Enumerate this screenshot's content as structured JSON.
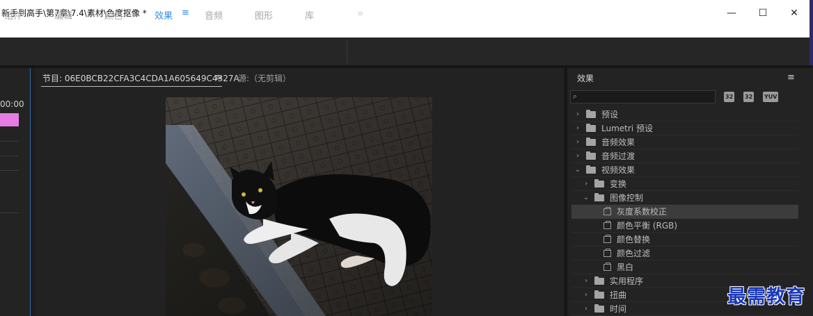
{
  "window": {
    "title": "新手到高手\\第7章\\7.4\\素材\\色度抠像 *",
    "minimize": "—",
    "maximize": "☐",
    "close": "✕"
  },
  "nav": {
    "items": [
      "组件",
      "编辑",
      "颜色",
      "效果",
      "音频",
      "图形",
      "库"
    ],
    "active_index": 3,
    "menu_icon": "≡",
    "more_icon": "»"
  },
  "timeline": {
    "timecode": "00:00",
    "clip_color": "#e47de1"
  },
  "monitor": {
    "program_tab": "节目: 06E0BCB22CFA3C4CDA1A605649C4327A",
    "menu_icon": "≡",
    "source_tab": "源:（无剪辑）"
  },
  "effects": {
    "title": "效果",
    "menu_icon": "≡",
    "search_placeholder": "",
    "search_icon": "⌕",
    "filters": [
      "32",
      "32",
      "YUV"
    ],
    "tree": [
      {
        "label": "预设",
        "level": 0,
        "type": "folder",
        "expanded": false
      },
      {
        "label": "Lumetri 预设",
        "level": 0,
        "type": "folder",
        "expanded": false
      },
      {
        "label": "音频效果",
        "level": 0,
        "type": "folder",
        "expanded": false
      },
      {
        "label": "音频过渡",
        "level": 0,
        "type": "folder",
        "expanded": false
      },
      {
        "label": "视频效果",
        "level": 0,
        "type": "folder",
        "expanded": true
      },
      {
        "label": "变换",
        "level": 1,
        "type": "folder",
        "expanded": false
      },
      {
        "label": "图像控制",
        "level": 1,
        "type": "folder",
        "expanded": true
      },
      {
        "label": "灰度系数校正",
        "level": 2,
        "type": "effect",
        "selected": true
      },
      {
        "label": "颜色平衡 (RGB)",
        "level": 2,
        "type": "effect"
      },
      {
        "label": "颜色替换",
        "level": 2,
        "type": "effect"
      },
      {
        "label": "颜色过滤",
        "level": 2,
        "type": "effect"
      },
      {
        "label": "黑白",
        "level": 2,
        "type": "effect"
      },
      {
        "label": "实用程序",
        "level": 1,
        "type": "folder",
        "expanded": false
      },
      {
        "label": "扭曲",
        "level": 1,
        "type": "folder",
        "expanded": false
      },
      {
        "label": "时间",
        "level": 1,
        "type": "folder",
        "expanded": false
      }
    ]
  },
  "watermark": "最需教育",
  "colors": {
    "accent": "#2d8ceb",
    "panel_bg": "#232323",
    "selection": "#3c3c3c"
  }
}
